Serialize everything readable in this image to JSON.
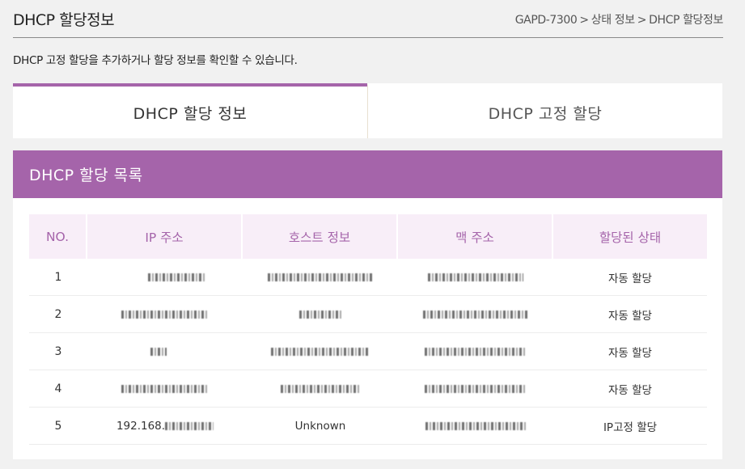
{
  "header": {
    "title": "DHCP 할당정보",
    "breadcrumb": [
      "GAPD-7300",
      "상태 정보",
      "DHCP 할당정보"
    ],
    "breadcrumb_sep": ">"
  },
  "description": "DHCP 고정 할당을 추가하거나 할당 정보를 확인할 수 있습니다.",
  "tabs": [
    {
      "label": "DHCP 할당 정보",
      "active": true
    },
    {
      "label": "DHCP 고정 할당",
      "active": false
    }
  ],
  "panel": {
    "title": "DHCP 할당 목록",
    "columns": [
      "NO.",
      "IP 주소",
      "호스트 정보",
      "맥 주소",
      "할당된 상태"
    ],
    "rows": [
      {
        "no": "1",
        "ip": "",
        "host": "",
        "mac": "",
        "status": "자동 할당"
      },
      {
        "no": "2",
        "ip": "",
        "host": "",
        "mac": "",
        "status": "자동 할당"
      },
      {
        "no": "3",
        "ip": "",
        "host": "",
        "mac": "",
        "status": "자동 할당"
      },
      {
        "no": "4",
        "ip": "",
        "host": "",
        "mac": "",
        "status": "자동 할당"
      },
      {
        "no": "5",
        "ip": "192.168.",
        "host": "Unknown",
        "mac": "",
        "status": "IP고정 할당"
      }
    ]
  },
  "colors": {
    "accent": "#a564aa",
    "header_bg": "#f8eef8",
    "page_bg": "#f1f1f1"
  }
}
